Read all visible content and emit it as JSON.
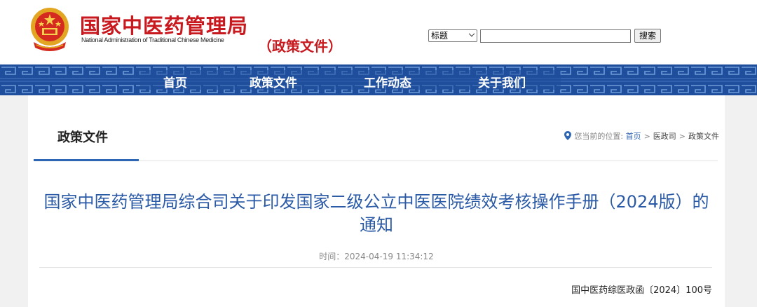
{
  "header": {
    "logo_cn": "国家中医药管理局",
    "logo_en": "National Administration of Traditional Chinese Medicine",
    "section_tag": "（政策文件）",
    "emblem_icon": "national-emblem-icon"
  },
  "search": {
    "select_value": "标题",
    "input_value": "",
    "button_label": "搜索"
  },
  "nav": {
    "items": [
      {
        "label": "首页"
      },
      {
        "label": "政策文件"
      },
      {
        "label": "工作动态"
      },
      {
        "label": "关于我们"
      }
    ]
  },
  "tab": {
    "title": "政策文件"
  },
  "breadcrumb": {
    "prefix": "您当前的位置:",
    "home": "首页",
    "level2": "医政司",
    "level3": "政策文件",
    "separator": ">",
    "icon": "location-pin-icon"
  },
  "article": {
    "title": "国家中医药管理局综合司关于印发国家二级公立中医医院绩效考核操作手册（2024版）的通知",
    "time": "时间：2024-04-19 11:34:12",
    "doc_number": "国中医药综医政函〔2024〕100号"
  },
  "colors": {
    "brand_red": "#c8191f",
    "nav_blue": "#1f4e9d",
    "title_blue": "#2a5aa6",
    "link_blue": "#2f66b3"
  }
}
